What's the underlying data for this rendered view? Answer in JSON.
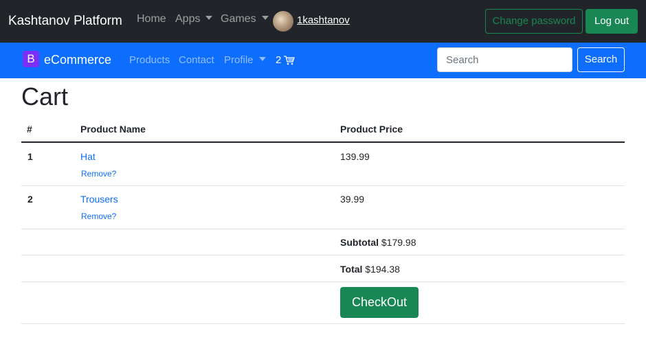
{
  "topnav": {
    "brand": "Kashtanov Platform",
    "links": [
      "Home",
      "Apps",
      "Games"
    ],
    "username": "1kashtanov",
    "change_password": "Change password",
    "logout": "Log out"
  },
  "shopnav": {
    "logo_letter": "B",
    "brand": "eCommerce",
    "links": [
      "Products",
      "Contact",
      "Profile"
    ],
    "cart_count": "2",
    "search_placeholder": "Search",
    "search_button": "Search"
  },
  "cart": {
    "title": "Cart",
    "headers": [
      "#",
      "Product Name",
      "Product Price"
    ],
    "rows": [
      {
        "index": "1",
        "name": "Hat",
        "remove": "Remove?",
        "price": "139.99"
      },
      {
        "index": "2",
        "name": "Trousers",
        "remove": "Remove?",
        "price": "39.99"
      }
    ],
    "subtotal_label": "Subtotal",
    "subtotal_value": "$179.98",
    "total_label": "Total",
    "total_value": "$194.38",
    "checkout": "CheckOut"
  },
  "colors": {
    "topbar": "#212529",
    "bluebar": "#0d6efd",
    "success": "#198754",
    "logo": "#7b2ff7"
  }
}
